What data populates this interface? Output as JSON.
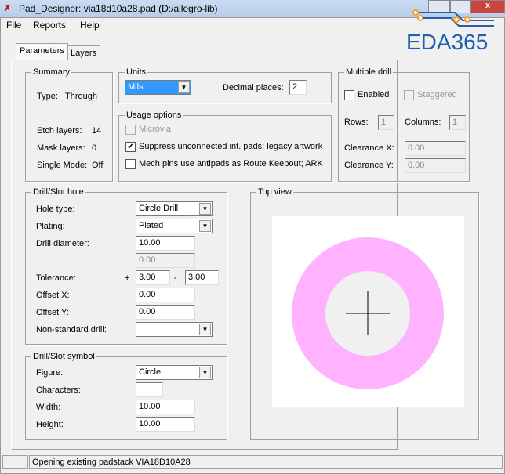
{
  "window": {
    "title": "Pad_Designer: via18d10a28.pad (D:/allegro-lib)",
    "logo_text": "EDA365"
  },
  "menu": [
    "File",
    "Reports",
    "Help"
  ],
  "tabs": [
    "Parameters",
    "Layers"
  ],
  "summary": {
    "title": "Summary",
    "type_label": "Type:",
    "type_value": "Through",
    "etch_label": "Etch layers:",
    "etch_value": "14",
    "mask_label": "Mask layers:",
    "mask_value": "0",
    "single_label": "Single Mode:",
    "single_value": "Off"
  },
  "units": {
    "title": "Units",
    "value": "Mils",
    "decimal_label": "Decimal places:",
    "decimal_value": "2"
  },
  "usage": {
    "title": "Usage options",
    "microvia": "Microvia",
    "suppress": "Suppress unconnected int. pads; legacy artwork",
    "suppress_checked": true,
    "mech": "Mech pins use antipads as Route Keepout; ARK"
  },
  "multi": {
    "title": "Multiple drill",
    "enabled": "Enabled",
    "staggered": "Staggered",
    "rows_label": "Rows:",
    "rows": "1",
    "cols_label": "Columns:",
    "cols": "1",
    "clrx_label": "Clearance X:",
    "clrx": "0.00",
    "clry_label": "Clearance Y:",
    "clry": "0.00"
  },
  "drill": {
    "title": "Drill/Slot hole",
    "hole_type_label": "Hole type:",
    "hole_type": "Circle Drill",
    "plating_label": "Plating:",
    "plating": "Plated",
    "diam_label": "Drill diameter:",
    "diam": "10.00",
    "diam2": "0.00",
    "tol_label": "Tolerance:",
    "plus": "+",
    "tol_plus": "3.00",
    "minus": "-",
    "tol_minus": "3.00",
    "offx_label": "Offset X:",
    "offx": "0.00",
    "offy_label": "Offset Y:",
    "offy": "0.00",
    "nonstd_label": "Non-standard drill:",
    "nonstd": ""
  },
  "symbol": {
    "title": "Drill/Slot symbol",
    "figure_label": "Figure:",
    "figure": "Circle",
    "chars_label": "Characters:",
    "chars": "",
    "width_label": "Width:",
    "width": "10.00",
    "height_label": "Height:",
    "height": "10.00"
  },
  "topview": {
    "title": "Top view",
    "pad_color": "#ffb3ff"
  },
  "status": "Opening existing padstack VIA18D10A28"
}
